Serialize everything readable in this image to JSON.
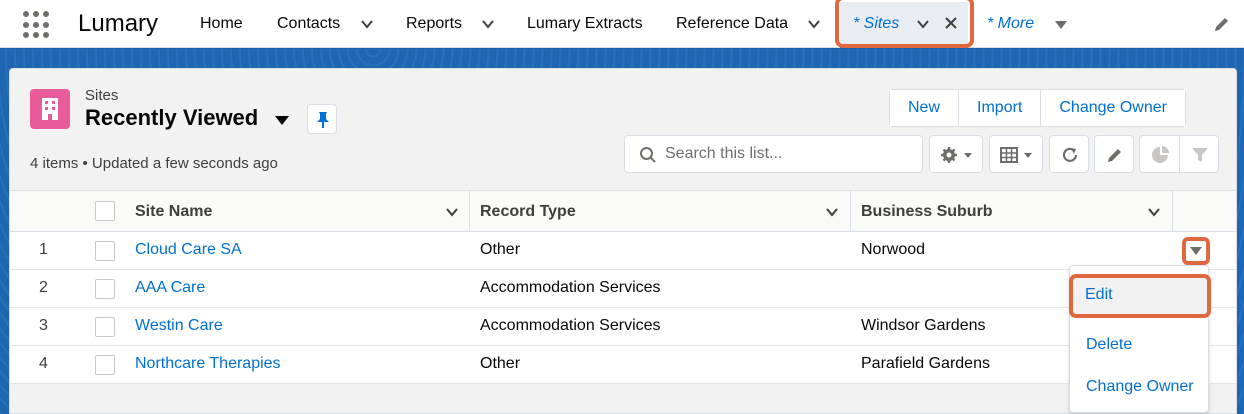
{
  "nav": {
    "app_name": "Lumary",
    "items": [
      {
        "label": "Home"
      },
      {
        "label": "Contacts"
      },
      {
        "label": "Reports"
      },
      {
        "label": "Lumary Extracts"
      },
      {
        "label": "Reference Data"
      }
    ],
    "active_tab": "* Sites",
    "more": "* More"
  },
  "list": {
    "object_label": "Sites",
    "view_name": "Recently Viewed",
    "meta": "4 items • Updated a few seconds ago",
    "search_placeholder": "Search this list...",
    "buttons": {
      "new": "New",
      "import": "Import",
      "change_owner": "Change Owner"
    }
  },
  "table": {
    "columns": [
      "Site Name",
      "Record Type",
      "Business Suburb"
    ],
    "rows": [
      {
        "num": "1",
        "name": "Cloud Care SA",
        "type": "Other",
        "suburb": "Norwood"
      },
      {
        "num": "2",
        "name": "AAA Care",
        "type": "Accommodation Services",
        "suburb": ""
      },
      {
        "num": "3",
        "name": "Westin Care",
        "type": "Accommodation Services",
        "suburb": "Windsor Gardens"
      },
      {
        "num": "4",
        "name": "Northcare Therapies",
        "type": "Other",
        "suburb": "Parafield Gardens"
      }
    ]
  },
  "row_menu": {
    "edit": "Edit",
    "delete": "Delete",
    "change_owner": "Change Owner"
  },
  "colors": {
    "brand_blue": "#0070d2",
    "highlight": "#e0683f",
    "sites_icon": "#e95c9b"
  }
}
